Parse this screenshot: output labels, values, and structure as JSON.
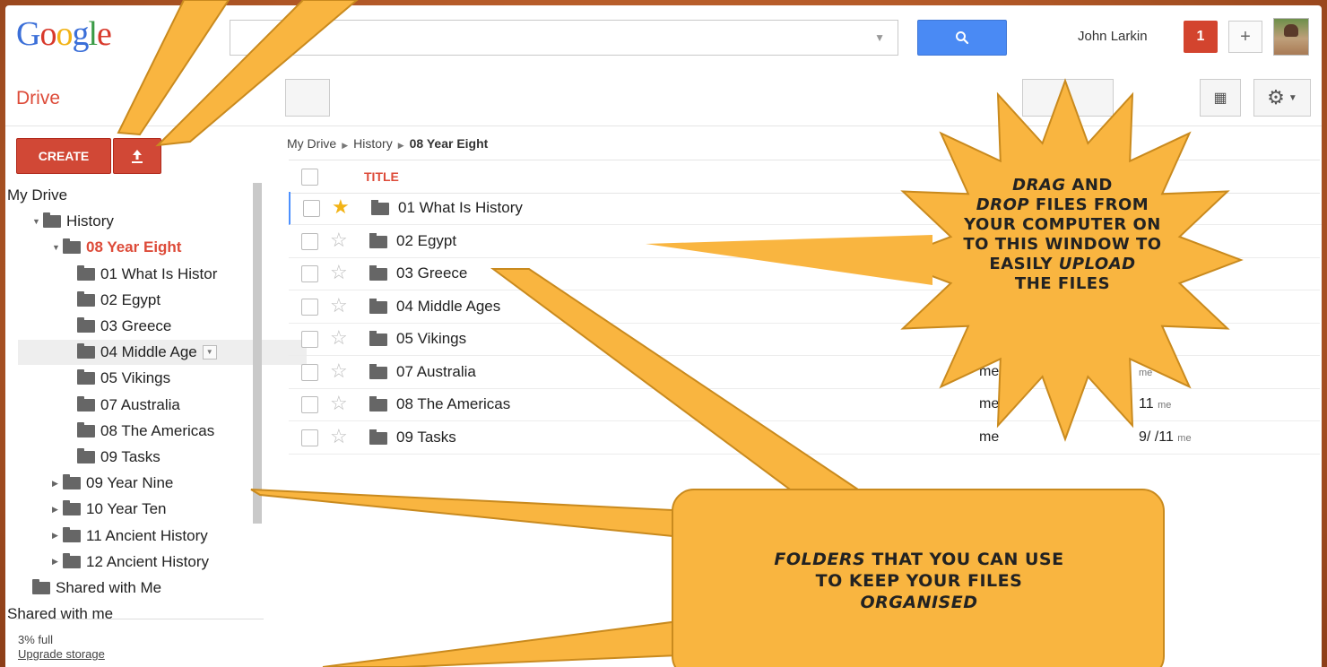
{
  "header": {
    "logo": [
      "G",
      "o",
      "o",
      "g",
      "l",
      "e"
    ],
    "search_value": "",
    "user_name": "John Larkin",
    "notification_count": "1",
    "plus_label": "+"
  },
  "drive": {
    "title": "Drive",
    "create_label": "CREATE",
    "upload_icon": "upload-icon"
  },
  "sidebar": {
    "tree": [
      {
        "label": "My Drive",
        "level": 0,
        "twisty": "",
        "folder": false
      },
      {
        "label": "History",
        "level": 1,
        "twisty": "▼",
        "folder": true
      },
      {
        "label": "08 Year Eight",
        "level": 2,
        "twisty": "▼",
        "folder": true,
        "current": true
      },
      {
        "label": "01 What Is Histor",
        "level": 3,
        "twisty": "",
        "folder": true
      },
      {
        "label": "02 Egypt",
        "level": 3,
        "twisty": "",
        "folder": true
      },
      {
        "label": "03 Greece",
        "level": 3,
        "twisty": "",
        "folder": true
      },
      {
        "label": "04 Middle Age",
        "level": 3,
        "twisty": "",
        "folder": true,
        "hovered": true
      },
      {
        "label": "05 Vikings",
        "level": 3,
        "twisty": "",
        "folder": true
      },
      {
        "label": "07 Australia",
        "level": 3,
        "twisty": "",
        "folder": true
      },
      {
        "label": "08 The Americas",
        "level": 3,
        "twisty": "",
        "folder": true
      },
      {
        "label": "09 Tasks",
        "level": 3,
        "twisty": "",
        "folder": true
      },
      {
        "label": "09 Year Nine",
        "level": 2,
        "twisty": "▶",
        "folder": true
      },
      {
        "label": "10 Year Ten",
        "level": 2,
        "twisty": "▶",
        "folder": true
      },
      {
        "label": "11 Ancient History",
        "level": 2,
        "twisty": "▶",
        "folder": true
      },
      {
        "label": "12 Ancient History",
        "level": 2,
        "twisty": "▶",
        "folder": true
      },
      {
        "label": "Shared with Me",
        "level": 1,
        "twisty": "",
        "folder": true
      },
      {
        "label": "Shared with me",
        "level": 0,
        "twisty": "",
        "folder": false
      }
    ],
    "quota": "3% full",
    "upgrade": "Upgrade storage"
  },
  "breadcrumb": {
    "items": [
      "My Drive",
      "History",
      "08 Year Eight"
    ]
  },
  "list": {
    "title_header": "TITLE",
    "rows": [
      {
        "name": "01 What Is History",
        "starred": true,
        "owner": "",
        "date": "",
        "date_by": ""
      },
      {
        "name": "02 Egypt",
        "starred": false,
        "owner": "",
        "date": "",
        "date_by": ""
      },
      {
        "name": "03 Greece",
        "starred": false,
        "owner": "",
        "date": "",
        "date_by": ""
      },
      {
        "name": "04 Middle Ages",
        "starred": false,
        "owner": "",
        "date": "",
        "date_by": ""
      },
      {
        "name": "05 Vikings",
        "starred": false,
        "owner": "",
        "date": "",
        "date_by": ""
      },
      {
        "name": "07 Australia",
        "starred": false,
        "owner": "me",
        "date": "",
        "date_by": "me"
      },
      {
        "name": "08 The Americas",
        "starred": false,
        "owner": "me",
        "date": "11",
        "date_by": "me"
      },
      {
        "name": "09 Tasks",
        "starred": false,
        "owner": "me",
        "date": "9/  /11",
        "date_by": "me"
      }
    ]
  },
  "callouts": {
    "drag_drop": {
      "lines": [
        [
          {
            "t": "Drag",
            "em": true
          },
          {
            "t": " and",
            "em": false
          }
        ],
        [
          {
            "t": "Drop",
            "em": true
          },
          {
            "t": " files from",
            "em": false
          }
        ],
        [
          {
            "t": "your computer on",
            "em": false
          }
        ],
        [
          {
            "t": "to this window to",
            "em": false
          }
        ],
        [
          {
            "t": "easily ",
            "em": false
          },
          {
            "t": "upload",
            "em": true
          }
        ],
        [
          {
            "t": "the files",
            "em": false
          }
        ]
      ]
    },
    "folders": {
      "lines": [
        [
          {
            "t": "Folders",
            "em": true
          },
          {
            "t": " that you can use",
            "em": false
          }
        ],
        [
          {
            "t": "to keep your files",
            "em": false
          }
        ],
        [
          {
            "t": "organised",
            "em": true
          }
        ]
      ]
    },
    "fill_color": "#f9b540",
    "stroke_color": "#c98a1e"
  },
  "colors": {
    "accent_red": "#d14836",
    "drive_red": "#dd4b39",
    "search_blue": "#4a8af4",
    "star_yellow": "#f2b316"
  }
}
